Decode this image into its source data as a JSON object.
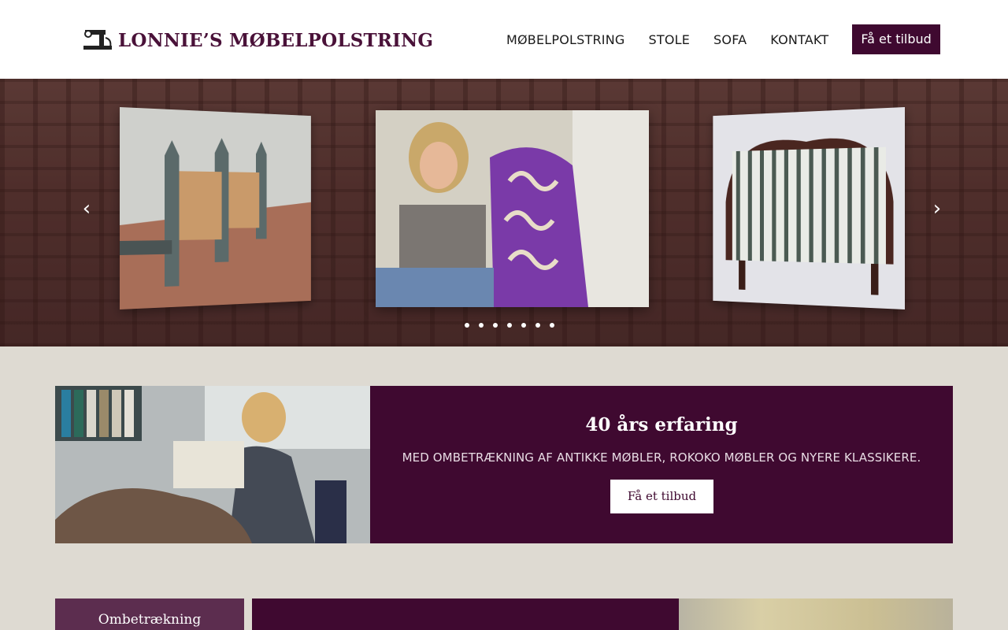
{
  "header": {
    "logo_text": "LONNIE’S MØBELPOLSTRING",
    "logo_icon": "sewing-machine-icon",
    "nav": [
      "MØBELPOLSTRING",
      "STOLE",
      "SOFA",
      "KONTAKT"
    ],
    "cta_label": "Få et tilbud"
  },
  "hero": {
    "prev_icon": "chevron-left-icon",
    "next_icon": "chevron-right-icon",
    "prev_glyph": "‹",
    "next_glyph": "›",
    "slides": [
      "church-pews-photo",
      "upholsterer-with-purple-chair-photo",
      "striped-sofa-photo"
    ],
    "dot_count": 7
  },
  "intro": {
    "title": "40 års erfaring",
    "subtitle": "MED OMBETRÆKNING AF ANTIKKE MØBLER, ROKOKO MØBLER OG NYERE KLASSIKERE.",
    "button_label": "Få et tilbud"
  },
  "bottom": {
    "tab_label": "Ombetrækning"
  },
  "colors": {
    "brand": "#3f0930",
    "brand_light": "#5c2d4f",
    "page_bg": "#dedad2"
  }
}
